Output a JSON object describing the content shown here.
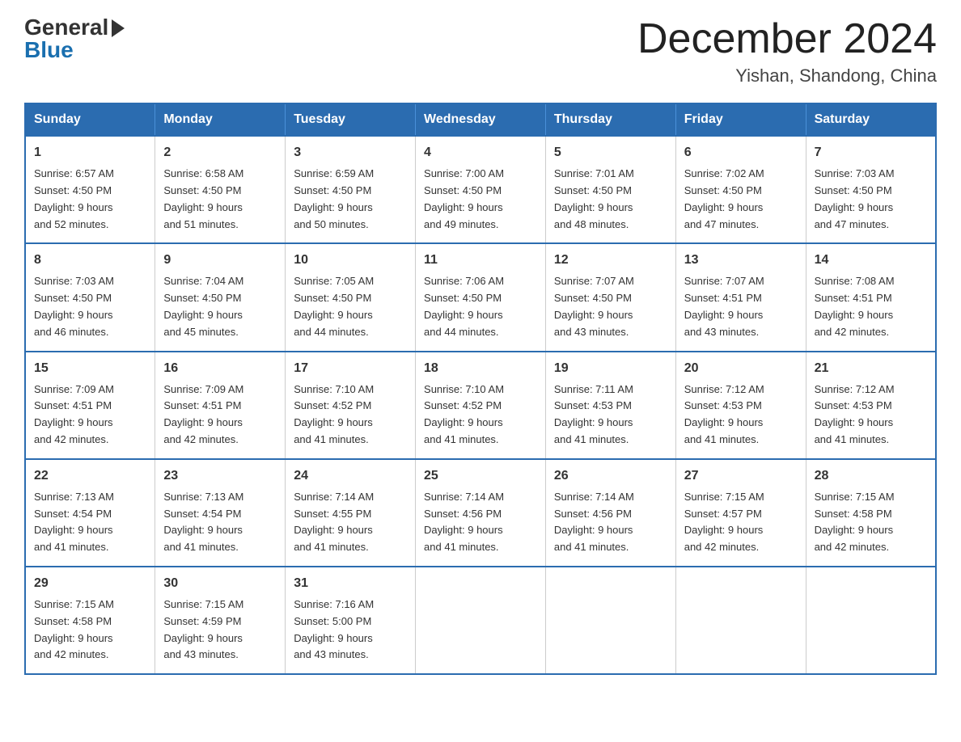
{
  "header": {
    "logo_general": "General",
    "logo_blue": "Blue",
    "month_title": "December 2024",
    "location": "Yishan, Shandong, China"
  },
  "days_of_week": [
    "Sunday",
    "Monday",
    "Tuesday",
    "Wednesday",
    "Thursday",
    "Friday",
    "Saturday"
  ],
  "weeks": [
    [
      {
        "day": "1",
        "sunrise": "6:57 AM",
        "sunset": "4:50 PM",
        "daylight": "9 hours and 52 minutes."
      },
      {
        "day": "2",
        "sunrise": "6:58 AM",
        "sunset": "4:50 PM",
        "daylight": "9 hours and 51 minutes."
      },
      {
        "day": "3",
        "sunrise": "6:59 AM",
        "sunset": "4:50 PM",
        "daylight": "9 hours and 50 minutes."
      },
      {
        "day": "4",
        "sunrise": "7:00 AM",
        "sunset": "4:50 PM",
        "daylight": "9 hours and 49 minutes."
      },
      {
        "day": "5",
        "sunrise": "7:01 AM",
        "sunset": "4:50 PM",
        "daylight": "9 hours and 48 minutes."
      },
      {
        "day": "6",
        "sunrise": "7:02 AM",
        "sunset": "4:50 PM",
        "daylight": "9 hours and 47 minutes."
      },
      {
        "day": "7",
        "sunrise": "7:03 AM",
        "sunset": "4:50 PM",
        "daylight": "9 hours and 47 minutes."
      }
    ],
    [
      {
        "day": "8",
        "sunrise": "7:03 AM",
        "sunset": "4:50 PM",
        "daylight": "9 hours and 46 minutes."
      },
      {
        "day": "9",
        "sunrise": "7:04 AM",
        "sunset": "4:50 PM",
        "daylight": "9 hours and 45 minutes."
      },
      {
        "day": "10",
        "sunrise": "7:05 AM",
        "sunset": "4:50 PM",
        "daylight": "9 hours and 44 minutes."
      },
      {
        "day": "11",
        "sunrise": "7:06 AM",
        "sunset": "4:50 PM",
        "daylight": "9 hours and 44 minutes."
      },
      {
        "day": "12",
        "sunrise": "7:07 AM",
        "sunset": "4:50 PM",
        "daylight": "9 hours and 43 minutes."
      },
      {
        "day": "13",
        "sunrise": "7:07 AM",
        "sunset": "4:51 PM",
        "daylight": "9 hours and 43 minutes."
      },
      {
        "day": "14",
        "sunrise": "7:08 AM",
        "sunset": "4:51 PM",
        "daylight": "9 hours and 42 minutes."
      }
    ],
    [
      {
        "day": "15",
        "sunrise": "7:09 AM",
        "sunset": "4:51 PM",
        "daylight": "9 hours and 42 minutes."
      },
      {
        "day": "16",
        "sunrise": "7:09 AM",
        "sunset": "4:51 PM",
        "daylight": "9 hours and 42 minutes."
      },
      {
        "day": "17",
        "sunrise": "7:10 AM",
        "sunset": "4:52 PM",
        "daylight": "9 hours and 41 minutes."
      },
      {
        "day": "18",
        "sunrise": "7:10 AM",
        "sunset": "4:52 PM",
        "daylight": "9 hours and 41 minutes."
      },
      {
        "day": "19",
        "sunrise": "7:11 AM",
        "sunset": "4:53 PM",
        "daylight": "9 hours and 41 minutes."
      },
      {
        "day": "20",
        "sunrise": "7:12 AM",
        "sunset": "4:53 PM",
        "daylight": "9 hours and 41 minutes."
      },
      {
        "day": "21",
        "sunrise": "7:12 AM",
        "sunset": "4:53 PM",
        "daylight": "9 hours and 41 minutes."
      }
    ],
    [
      {
        "day": "22",
        "sunrise": "7:13 AM",
        "sunset": "4:54 PM",
        "daylight": "9 hours and 41 minutes."
      },
      {
        "day": "23",
        "sunrise": "7:13 AM",
        "sunset": "4:54 PM",
        "daylight": "9 hours and 41 minutes."
      },
      {
        "day": "24",
        "sunrise": "7:14 AM",
        "sunset": "4:55 PM",
        "daylight": "9 hours and 41 minutes."
      },
      {
        "day": "25",
        "sunrise": "7:14 AM",
        "sunset": "4:56 PM",
        "daylight": "9 hours and 41 minutes."
      },
      {
        "day": "26",
        "sunrise": "7:14 AM",
        "sunset": "4:56 PM",
        "daylight": "9 hours and 41 minutes."
      },
      {
        "day": "27",
        "sunrise": "7:15 AM",
        "sunset": "4:57 PM",
        "daylight": "9 hours and 42 minutes."
      },
      {
        "day": "28",
        "sunrise": "7:15 AM",
        "sunset": "4:58 PM",
        "daylight": "9 hours and 42 minutes."
      }
    ],
    [
      {
        "day": "29",
        "sunrise": "7:15 AM",
        "sunset": "4:58 PM",
        "daylight": "9 hours and 42 minutes."
      },
      {
        "day": "30",
        "sunrise": "7:15 AM",
        "sunset": "4:59 PM",
        "daylight": "9 hours and 43 minutes."
      },
      {
        "day": "31",
        "sunrise": "7:16 AM",
        "sunset": "5:00 PM",
        "daylight": "9 hours and 43 minutes."
      },
      null,
      null,
      null,
      null
    ]
  ],
  "labels": {
    "sunrise": "Sunrise:",
    "sunset": "Sunset:",
    "daylight": "Daylight:"
  }
}
